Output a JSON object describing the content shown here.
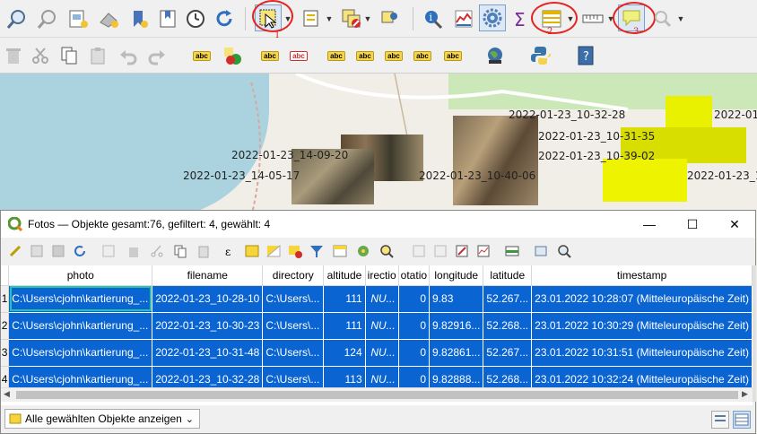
{
  "toolbar_main": {
    "icons": [
      "identify-zoom-icon",
      "pan-to-selection-icon",
      "new-print-layout-icon",
      "layout-manager-icon",
      "new-bookmark-icon",
      "show-bookmarks-icon",
      "temporal-controller-icon",
      "refresh-icon",
      "select-features-icon",
      "select-by-value-icon",
      "deselect-icon",
      "show-map-tips-icon",
      "identify-features-icon",
      "statistics-icon",
      "processing-toolbox-icon",
      "sum-icon",
      "open-attribute-table-icon",
      "measure-line-icon",
      "map-tips-icon",
      "locator-icon"
    ],
    "annotations": [
      "1",
      "2",
      "3"
    ]
  },
  "toolbar_edit": {
    "label_abc": "abc",
    "icons": [
      "delete-icon",
      "cut-icon",
      "copy-icon",
      "paste-icon",
      "undo-icon",
      "redo-icon",
      "label-icon",
      "color-label-icon",
      "pin-label-icon",
      "highlight-label-icon",
      "move-label-icon",
      "show-hide-label-icon",
      "move-label2-icon",
      "rotate-label-icon",
      "change-label-icon",
      "globe-plugin-icon",
      "python-icon",
      "help-icon"
    ]
  },
  "map": {
    "labels": [
      "2022-01-23_10-32-28",
      "2022-01",
      "2022-01-23_10-31-35",
      "2022-01-23_10-39-02",
      "2022-01-23_14-09-20",
      "2022-01-23_14-05-17",
      "2022-01-23_10-40-06",
      "2022-01-23_1"
    ]
  },
  "window": {
    "title": "Fotos — Objekte gesamt:76, gefiltert: 4, gewählt: 4",
    "minimize": "—",
    "maximize": "☐",
    "close": "✕"
  },
  "table": {
    "columns": [
      "photo",
      "filename",
      "directory",
      "altitude",
      "irectio",
      "otatio",
      "longitude",
      "latitude",
      "timestamp"
    ],
    "rows": [
      {
        "n": "1",
        "photo": "C:\\Users\\cjohn\\kartierung_...",
        "filename": "2022-01-23_10-28-10",
        "directory": "C:\\Users\\...",
        "altitude": "111",
        "direction": "NU...",
        "rotation": "0",
        "longitude": "9.83",
        "latitude": "52.267...",
        "timestamp": "23.01.2022 10:28:07 (Mitteleuropäische Zeit)"
      },
      {
        "n": "2",
        "photo": "C:\\Users\\cjohn\\kartierung_...",
        "filename": "2022-01-23_10-30-23",
        "directory": "C:\\Users\\...",
        "altitude": "111",
        "direction": "NU...",
        "rotation": "0",
        "longitude": "9.82916...",
        "latitude": "52.268...",
        "timestamp": "23.01.2022 10:30:29 (Mitteleuropäische Zeit)"
      },
      {
        "n": "3",
        "photo": "C:\\Users\\cjohn\\kartierung_...",
        "filename": "2022-01-23_10-31-48",
        "directory": "C:\\Users\\...",
        "altitude": "124",
        "direction": "NU...",
        "rotation": "0",
        "longitude": "9.82861...",
        "latitude": "52.267...",
        "timestamp": "23.01.2022 10:31:51 (Mitteleuropäische Zeit)"
      },
      {
        "n": "4",
        "photo": "C:\\Users\\cjohn\\kartierung_...",
        "filename": "2022-01-23_10-32-28",
        "directory": "C:\\Users\\...",
        "altitude": "113",
        "direction": "NU...",
        "rotation": "0",
        "longitude": "9.82888...",
        "latitude": "52.268...",
        "timestamp": "23.01.2022 10:32:24 (Mitteleuropäische Zeit)"
      }
    ]
  },
  "footer": {
    "filter_label": "Alle gewählten Objekte anzeigen",
    "dropdown_arrow": "⌄"
  },
  "colors": {
    "selection": "#0a64d2",
    "focus_cell": "#28c3a8",
    "annotation": "#e52420",
    "highlight_yellow": "#ffff00"
  }
}
